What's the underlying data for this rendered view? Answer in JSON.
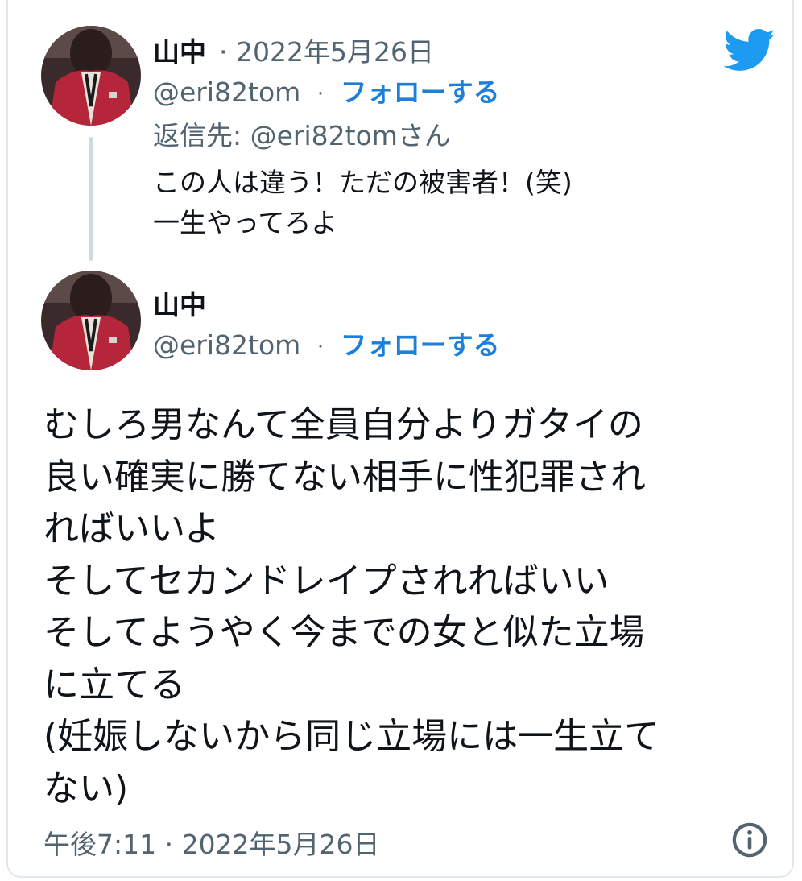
{
  "reply_tweet": {
    "name": "山中",
    "date": "2022年5月26日",
    "handle": "@eri82tom",
    "follow_label": "フォローする",
    "replying_to": "返信先: @eri82tomさん",
    "body": "この人は違う！ただの被害者！(笑)\n一生やってろよ"
  },
  "main_tweet": {
    "name": "山中",
    "handle": "@eri82tom",
    "follow_label": "フォローする",
    "body": "むしろ男なんて全員自分よりガタイの\n良い確実に勝てない相手に性犯罪され\nればいいよ\nそしてセカンドレイプされればいい\nそしてようやく今までの女と似た立場\nに立てる\n(妊娠しないから同じ立場には一生立て\nない)",
    "timestamp": "午後7:11 · 2022年5月26日"
  },
  "separator": "·",
  "icons": {
    "brand": "twitter-bird-icon",
    "info": "info-icon"
  },
  "colors": {
    "twitter_blue": "#1d9bf0",
    "follow_blue": "#1d7fd8",
    "secondary_text": "#536471",
    "thread_line": "#cfd9de"
  }
}
